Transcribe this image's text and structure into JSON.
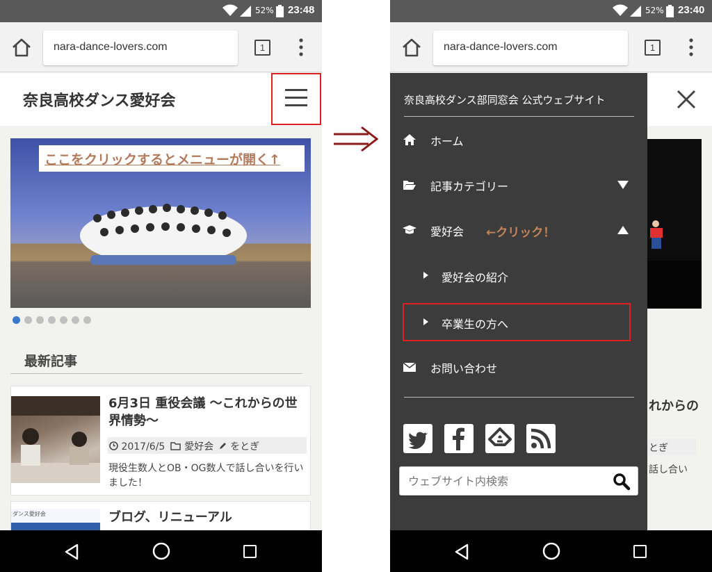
{
  "status_left": {
    "battery_pct": "52%",
    "time": "23:48"
  },
  "status_right": {
    "battery_pct": "52%",
    "time": "23:40"
  },
  "browser": {
    "url": "nara-dance-lovers.com",
    "tab_count": "1"
  },
  "site": {
    "title": "奈良高校ダンス愛好会"
  },
  "slider": {
    "caption": "ここをクリックするとメニューが開く↑",
    "dot_count": 7,
    "active_dot": 0
  },
  "latest": {
    "heading": "最新記事",
    "articles": [
      {
        "title": "6月3日 重役会議 〜これからの世界情勢〜",
        "date": "2017/6/5",
        "category": "愛好会",
        "author": "をとぎ",
        "excerpt": "現役生数人とOB・OG数人で話し合いを行いました！"
      },
      {
        "title": "ブログ、リニューアル",
        "thumb_text": "ダンス愛好会"
      }
    ]
  },
  "drawer": {
    "title": "奈良高校ダンス部同窓会 公式ウェブサイト",
    "menu": [
      {
        "label": "ホーム",
        "icon": "home-icon"
      },
      {
        "label": "記事カテゴリー",
        "icon": "folder-open-icon",
        "caret": "down"
      },
      {
        "label": "愛好会",
        "icon": "graduation-cap-icon",
        "caret": "up",
        "note": "←クリック！"
      }
    ],
    "submenu": [
      {
        "label": "愛好会の紹介"
      },
      {
        "label": "卒業生の方へ"
      }
    ],
    "contact": {
      "label": "お問い合わせ",
      "icon": "envelope-icon"
    },
    "social": [
      "twitter-icon",
      "facebook-icon",
      "feedly-icon",
      "rss-icon"
    ],
    "search_placeholder": "ウェブサイト内検索"
  },
  "peek": {
    "title_fragment": "れからの",
    "meta_fragment": "とぎ",
    "excerpt_fragment": "話し合い"
  },
  "colors": {
    "highlight": "#e02020",
    "annotation": "#b2795a",
    "drawer_bg": "#3c3c3c",
    "status_bar": "#595959"
  }
}
